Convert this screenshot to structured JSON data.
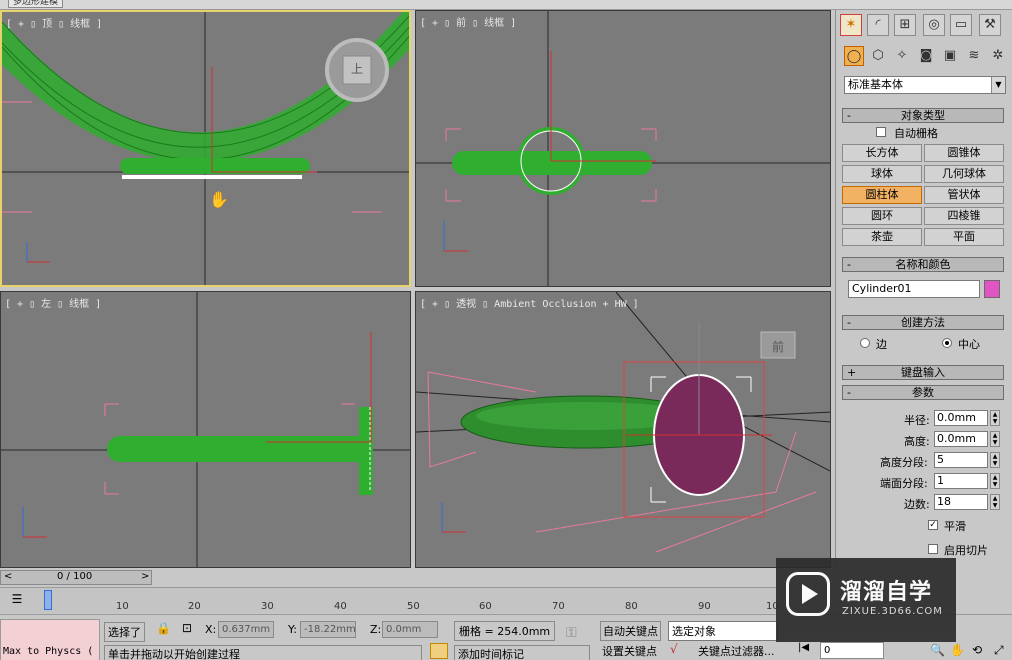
{
  "window": {
    "title": "多边形建模"
  },
  "viewports": {
    "top": {
      "label": "[ + ▯ 顶 ▯ 线框 ]",
      "viewcube_label": "上"
    },
    "front": {
      "label": "[ + ▯ 前 ▯ 线框 ]"
    },
    "left": {
      "label": "[ + ▯ 左 ▯ 线框 ]"
    },
    "persp": {
      "label": "[ + ▯ 透视 ▯ Ambient Occlusion + HW ]",
      "viewcube_label": "前"
    }
  },
  "panel": {
    "category_dropdown": "标准基本体",
    "object_type": {
      "header": "对象类型",
      "autogrid": "自动栅格",
      "buttons": [
        "长方体",
        "圆锥体",
        "球体",
        "几何球体",
        "圆柱体",
        "管状体",
        "圆环",
        "四棱锥",
        "茶壶",
        "平面"
      ],
      "selected_index": 4
    },
    "name_color": {
      "header": "名称和颜色",
      "name": "Cylinder01",
      "color": "#e054c4"
    },
    "creation_method": {
      "header": "创建方法",
      "edge": "边",
      "center": "中心"
    },
    "keyboard_entry": {
      "header": "键盘输入"
    },
    "parameters": {
      "header": "参数",
      "radius_label": "半径:",
      "radius": "0.0mm",
      "height_label": "高度:",
      "height": "0.0mm",
      "height_segs_label": "高度分段:",
      "height_segs": "5",
      "cap_segs_label": "端面分段:",
      "cap_segs": "1",
      "sides_label": "边数:",
      "sides": "18",
      "smooth": "平滑",
      "slice_on": "启用切片"
    }
  },
  "timeline": {
    "frame": "0 / 100",
    "prev": "<",
    "next": ">",
    "ticks": [
      "0",
      "10",
      "20",
      "30",
      "40",
      "50",
      "60",
      "70",
      "80",
      "90",
      "10"
    ]
  },
  "status": {
    "selected": "选择了",
    "x_label": "X:",
    "x": "0.637mm",
    "y_label": "Y:",
    "y": "-18.22mm",
    "z_label": "Z:",
    "z": "0.0mm",
    "grid": "栅格 = 254.0mm",
    "auto_key": "自动关键点",
    "selected_obj": "选定对象",
    "set_key": "设置关键点",
    "key_filters": "关键点过滤器...",
    "add_time_tag": "添加时间标记",
    "prompt": "单击并拖动以开始创建过程",
    "maxscript": "Max to Physcs (",
    "frame_field": "0"
  },
  "watermark": {
    "brand": "溜溜自学",
    "url": "ZIXUE.3D66.COM"
  },
  "colors": {
    "viewport_bg": "#7b7b7b",
    "wire_green": "#2fae2f",
    "accent_orange": "#f2b264",
    "pink_bbox": "#e87a9a"
  }
}
